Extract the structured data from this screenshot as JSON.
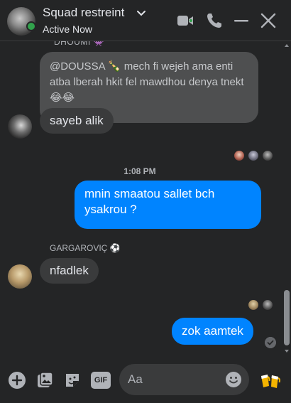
{
  "header": {
    "title": "Squad restreint",
    "status": "Active Now",
    "accent": "#0084ff",
    "icons": [
      "chevron-down-icon",
      "video-call-icon",
      "phone-icon",
      "minimize-icon",
      "close-icon"
    ]
  },
  "messages": {
    "top_sender": "DHOUMI 👾",
    "quoted_text": "@DOUSSA 🍾 mech fi wejeh ama enti atba lberah hkit fel mawdhou denya tnekt 😂😂",
    "reply_1": "sayeb alik",
    "timestamp": "1:08 PM",
    "outgoing_1_line1": "mnin smaatou sallet bch",
    "outgoing_1_line2": "ysakrou ?",
    "sender_2": "GARGAROVIÇ ⚽",
    "reply_2": "nfadlek",
    "outgoing_2": "zok aamtek"
  },
  "composer": {
    "placeholder": "Aa",
    "icons": [
      "add-icon",
      "gallery-icon",
      "sticker-icon",
      "gif-icon",
      "emoji-icon",
      "cheers-icon"
    ],
    "gif_label": "GIF"
  }
}
